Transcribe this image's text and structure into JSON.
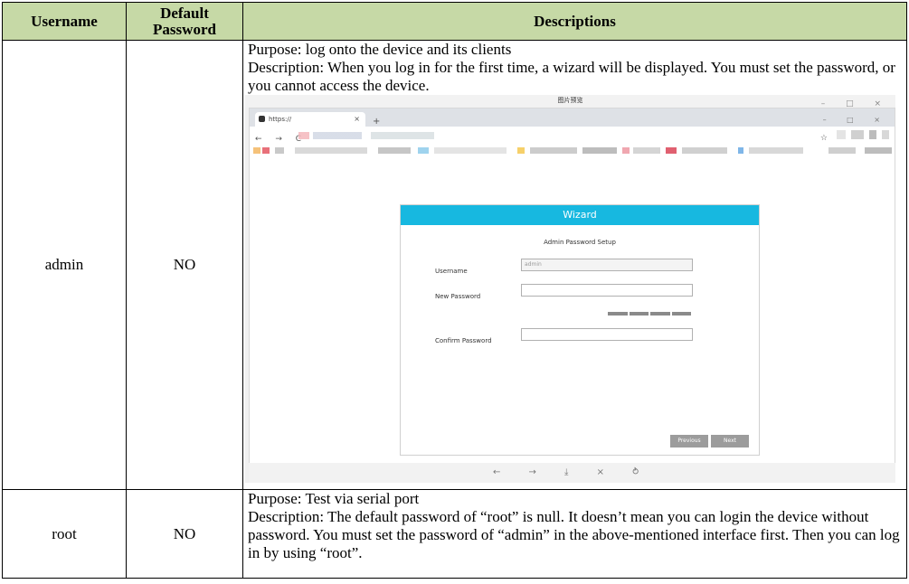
{
  "table": {
    "headers": {
      "username": "Username",
      "default_password": "Default Password",
      "descriptions": "Descriptions"
    },
    "rows": [
      {
        "username": "admin",
        "default_password": "NO",
        "purpose": "Purpose: log onto the device and its clients",
        "description": "Description: When you log in for the first time, a wizard will be displayed. You must set the password, or you cannot access the device."
      },
      {
        "username": "root",
        "default_password": "NO",
        "purpose": "Purpose: Test via serial port",
        "description": "Description: The default password of “root” is null. It doesn’t mean you can login the device without password. You must set the password of “admin” in the above-mentioned interface first. Then you can log in by using “root”."
      }
    ]
  },
  "screenshot": {
    "window_title": "图片预览",
    "window_controls": "– □ ×",
    "tab_label": "https://",
    "tab_close": "×",
    "new_tab": "+",
    "browser_controls": "– □ ×",
    "nav_icons": "← → C",
    "star": "☆",
    "wizard": {
      "title": "Wizard",
      "subtitle": "Admin Password Setup",
      "username_label": "Username",
      "username_value": "admin",
      "new_password_label": "New Password",
      "confirm_password_label": "Confirm Password",
      "previous_button": "Previous",
      "next_button": "Next"
    },
    "bottom_toolbar": "← → ⤓ × ⥁"
  }
}
